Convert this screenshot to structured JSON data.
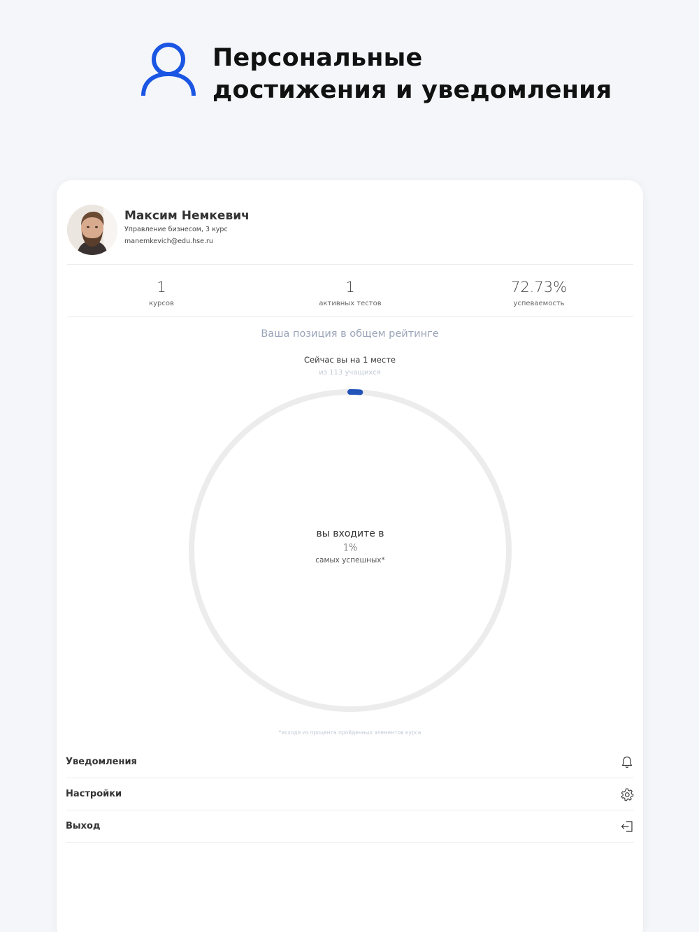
{
  "promo": {
    "icon": "user-icon",
    "title_line1": "Персональные",
    "title_line2": "достижения и уведомления",
    "accent_color": "#1a55e3"
  },
  "profile": {
    "name": "Максим Немкевич",
    "program": "Управление бизнесом, 3 курс",
    "email": "manemkevich@edu.hse.ru"
  },
  "stats": [
    {
      "value": "1",
      "label": "курсов"
    },
    {
      "value": "1",
      "label": "активных тестов"
    },
    {
      "value": "72.73%",
      "label": "успеваемость"
    }
  ],
  "rating": {
    "title": "Ваша позиция в общем рейтинге",
    "place_prefix": "Сейчас вы на",
    "place_value": "1",
    "place_suffix": "месте",
    "of_total": "из 113 учащихся",
    "progress_fraction": 0.01,
    "ring_text_line1": "вы входите в",
    "ring_percent": "1%",
    "ring_text_line3": "самых успешных*",
    "ring_color": "#2153b8",
    "track_color": "#ececec",
    "footnote": "*исходя из процента пройденных элементов курса"
  },
  "menu": [
    {
      "label": "Уведомления",
      "icon": "bell-icon"
    },
    {
      "label": "Настройки",
      "icon": "gear-icon"
    },
    {
      "label": "Выход",
      "icon": "logout-icon"
    }
  ]
}
